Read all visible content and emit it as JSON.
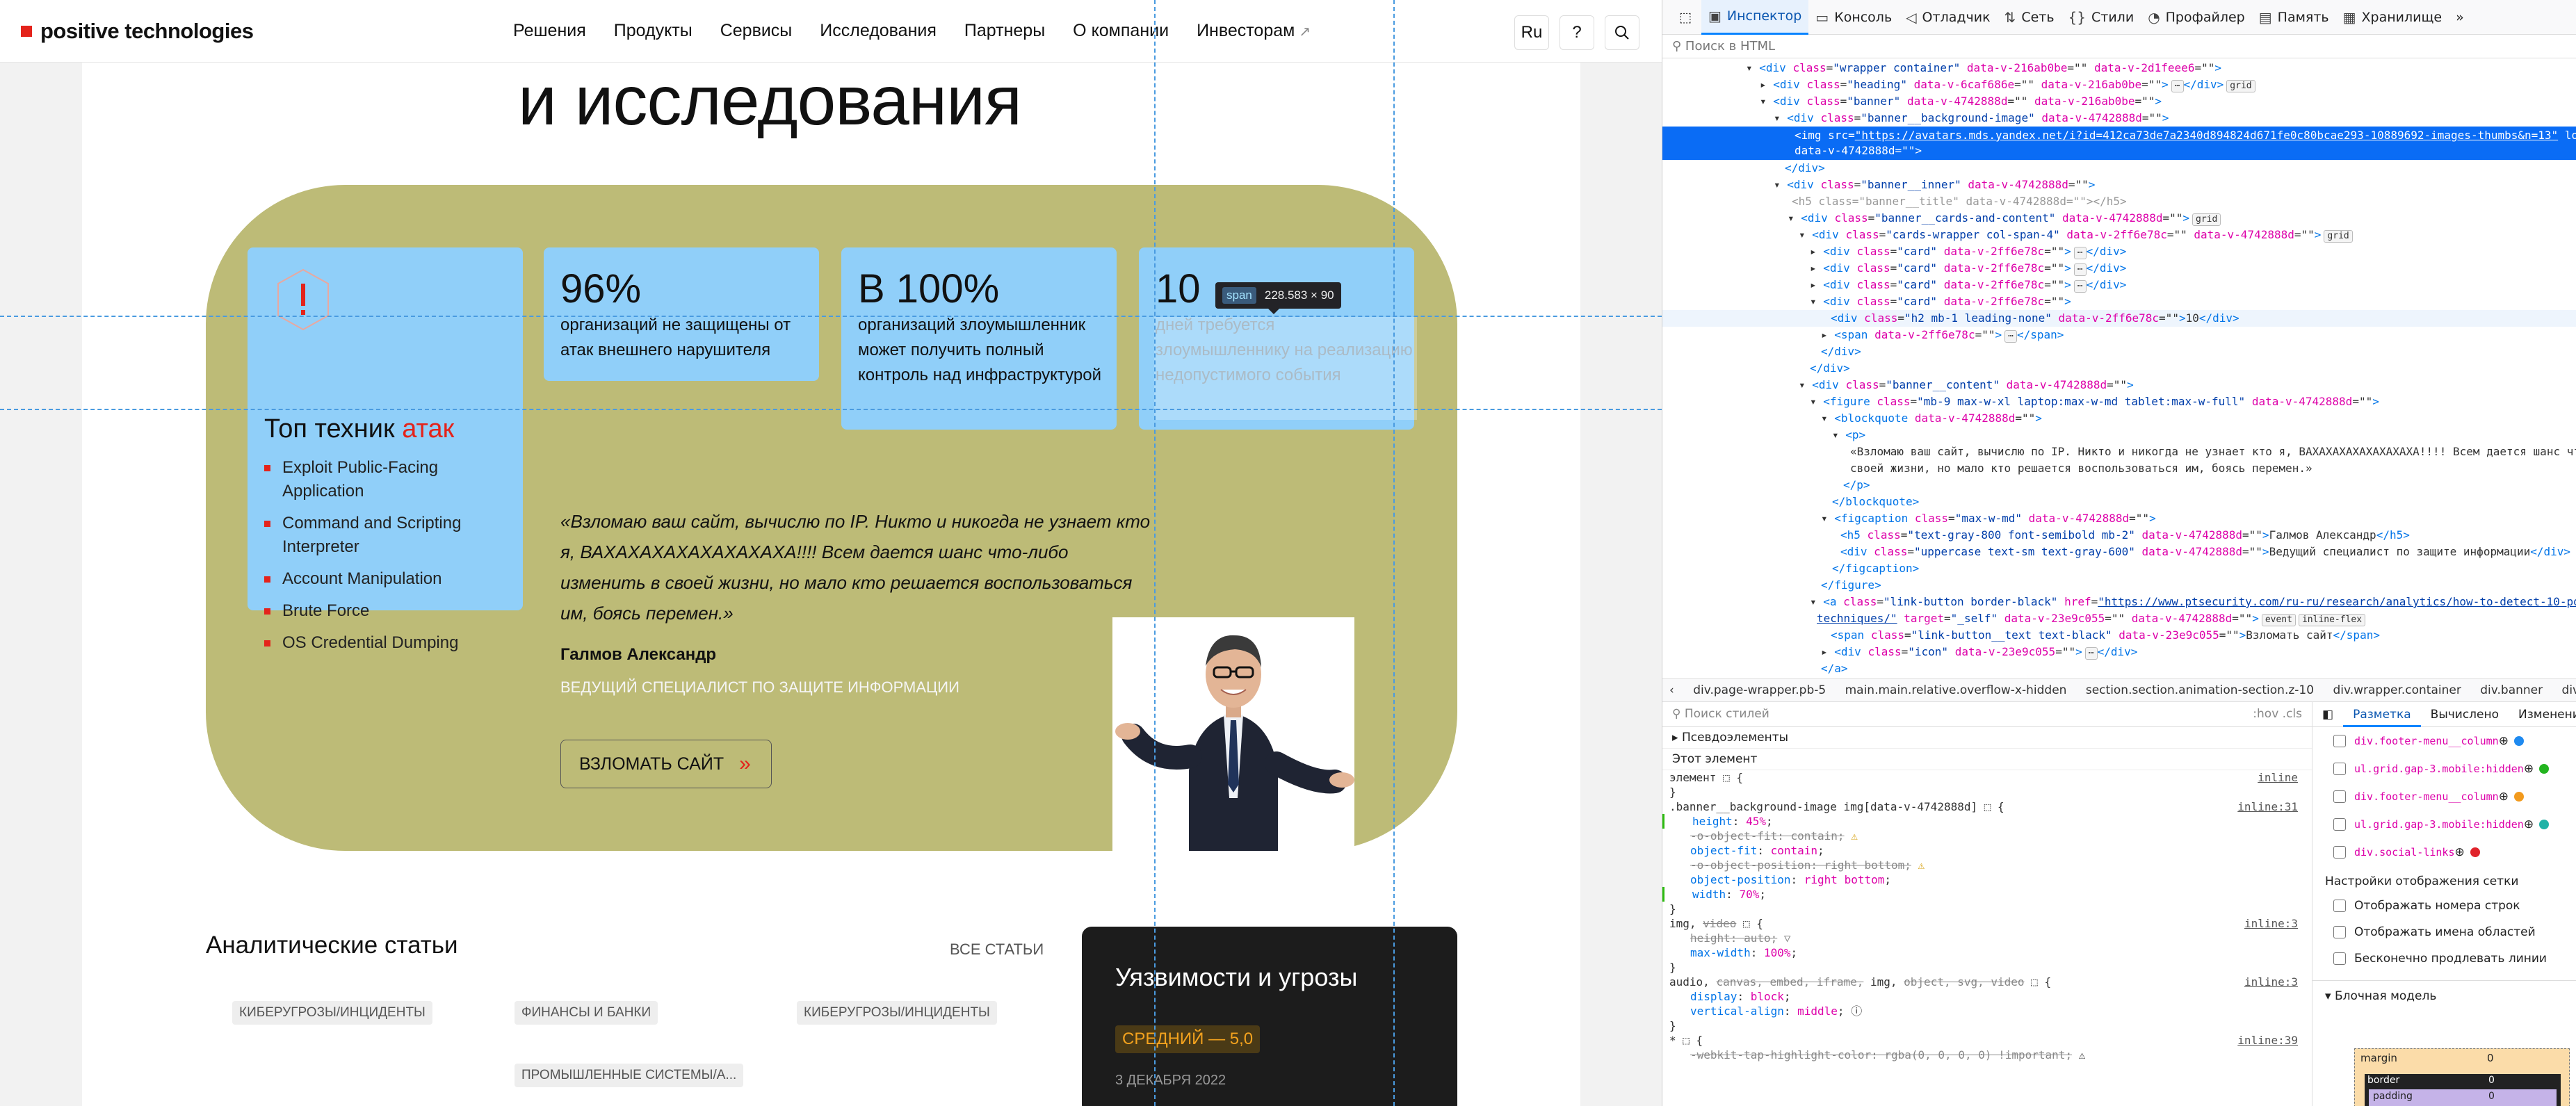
{
  "site": {
    "logo_text": "positive technologies",
    "nav": [
      "Решения",
      "Продукты",
      "Сервисы",
      "Исследования",
      "Партнеры",
      "О компании",
      "Инвесторам"
    ],
    "lang_button": "Ru",
    "help_button": "?",
    "hero_title": "и исследования",
    "cards": [
      {
        "big": "96%",
        "small": "организаций не защищены от атак внешнего нарушителя"
      },
      {
        "big": "В 100%",
        "small": "организаций злоумышленник может получить полный контроль над инфраструктурой"
      },
      {
        "big": "10",
        "small": "дней требуется злоумышленнику на реализацию недопустимого события"
      }
    ],
    "tech_title": "Топ техник",
    "tech_title_accent": "атак",
    "tech_list": [
      "Exploit Public-Facing Application",
      "Command and Scripting Interpreter",
      "Account Manipulation",
      "Brute Force",
      "OS Credential Dumping"
    ],
    "quote": "«Взломаю ваш сайт, вычислю по IP. Никто и никогда не узнает кто я, ВАХАХАХАХАХАХАХАХА!!!! Всем дается шанс что-либо изменить в своей жизни, но мало кто решается воспользоваться им, боясь перемен.»",
    "author_name": "Галмов Александр",
    "author_role": "Ведущий специалист по защите информации",
    "hack_button": "Взломать сайт",
    "articles_title": "Аналитические статьи",
    "all_articles": "Все статьи",
    "article_tags": [
      [
        "Киберугрозы/инциденты"
      ],
      [
        "Финансы и банки",
        "Промышленные системы/А..."
      ],
      [
        "Киберугрозы/инциденты"
      ]
    ],
    "vuln_title": "Уязвимости и угрозы",
    "vuln_badge": "Средний — 5,0",
    "vuln_date": "3 декабря 2022",
    "tooltip_tag": "span",
    "tooltip_dims": "228.583 × 90"
  },
  "devtools": {
    "tabs": [
      "Инспектор",
      "Консоль",
      "Отладчик",
      "Сеть",
      "Стили",
      "Профайлер",
      "Память",
      "Хранилище"
    ],
    "search_placeholder": "Поиск в HTML",
    "breadcrumbs": [
      "div.page-wrapper.pb-5",
      "main.main.relative.overflow-x-hidden",
      "section.section.animation-section.z-10",
      "div.wrapper.container",
      "div.banner",
      "div.banner__background-i"
    ],
    "styles_filter": "Поиск стилей",
    "styles_buttons": ":hov .cls",
    "pseudo": "Псевдоэлементы",
    "this_element": "Этот элемент",
    "layout_tabs": [
      "Разметка",
      "Вычислено",
      "Изменения"
    ],
    "grid_items": [
      "div.footer-menu__column",
      "ul.grid.gap-3.mobile:hidden",
      "div.footer-menu__column",
      "ul.grid.gap-3.mobile:hidden",
      "div.social-links"
    ],
    "grid_settings_title": "Настройки отображения сетки",
    "grid_settings": [
      "Отображать номера строк",
      "Отображать имена областей",
      "Бесконечно продлевать линии"
    ],
    "box_model_title": "Блочная модель",
    "box_margin": "margin",
    "box_border": "border",
    "box_padding": "padding",
    "zero": "0"
  }
}
